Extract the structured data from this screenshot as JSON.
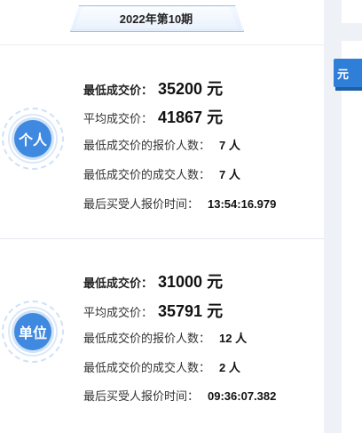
{
  "period": {
    "label": "2022年第10期"
  },
  "sections": [
    {
      "badge": "个人",
      "rows": {
        "min_price_label": "最低成交价：",
        "min_price_value": "35200 元",
        "avg_price_label": "平均成交价：",
        "avg_price_value": "41867 元",
        "min_bidders_label": "最低成交价的报价人数：",
        "min_bidders_value": "7 人",
        "min_deals_label": "最低成交价的成交人数：",
        "min_deals_value": "7 人",
        "last_time_label": "最后买受人报价时间：",
        "last_time_value": "13:54:16.979"
      }
    },
    {
      "badge": "单位",
      "rows": {
        "min_price_label": "最低成交价：",
        "min_price_value": "31000 元",
        "avg_price_label": "平均成交价：",
        "avg_price_value": "35791 元",
        "min_bidders_label": "最低成交价的报价人数：",
        "min_bidders_value": "12 人",
        "min_deals_label": "最低成交价的成交人数：",
        "min_deals_value": "2 人",
        "last_time_label": "最后买受人报价时间：",
        "last_time_value": "09:36:07.382"
      }
    }
  ],
  "right_button": {
    "label": "元"
  },
  "colors": {
    "accent": "#3f8ae0",
    "button": "#2f7fd9",
    "ring": "#cfe1f6"
  }
}
